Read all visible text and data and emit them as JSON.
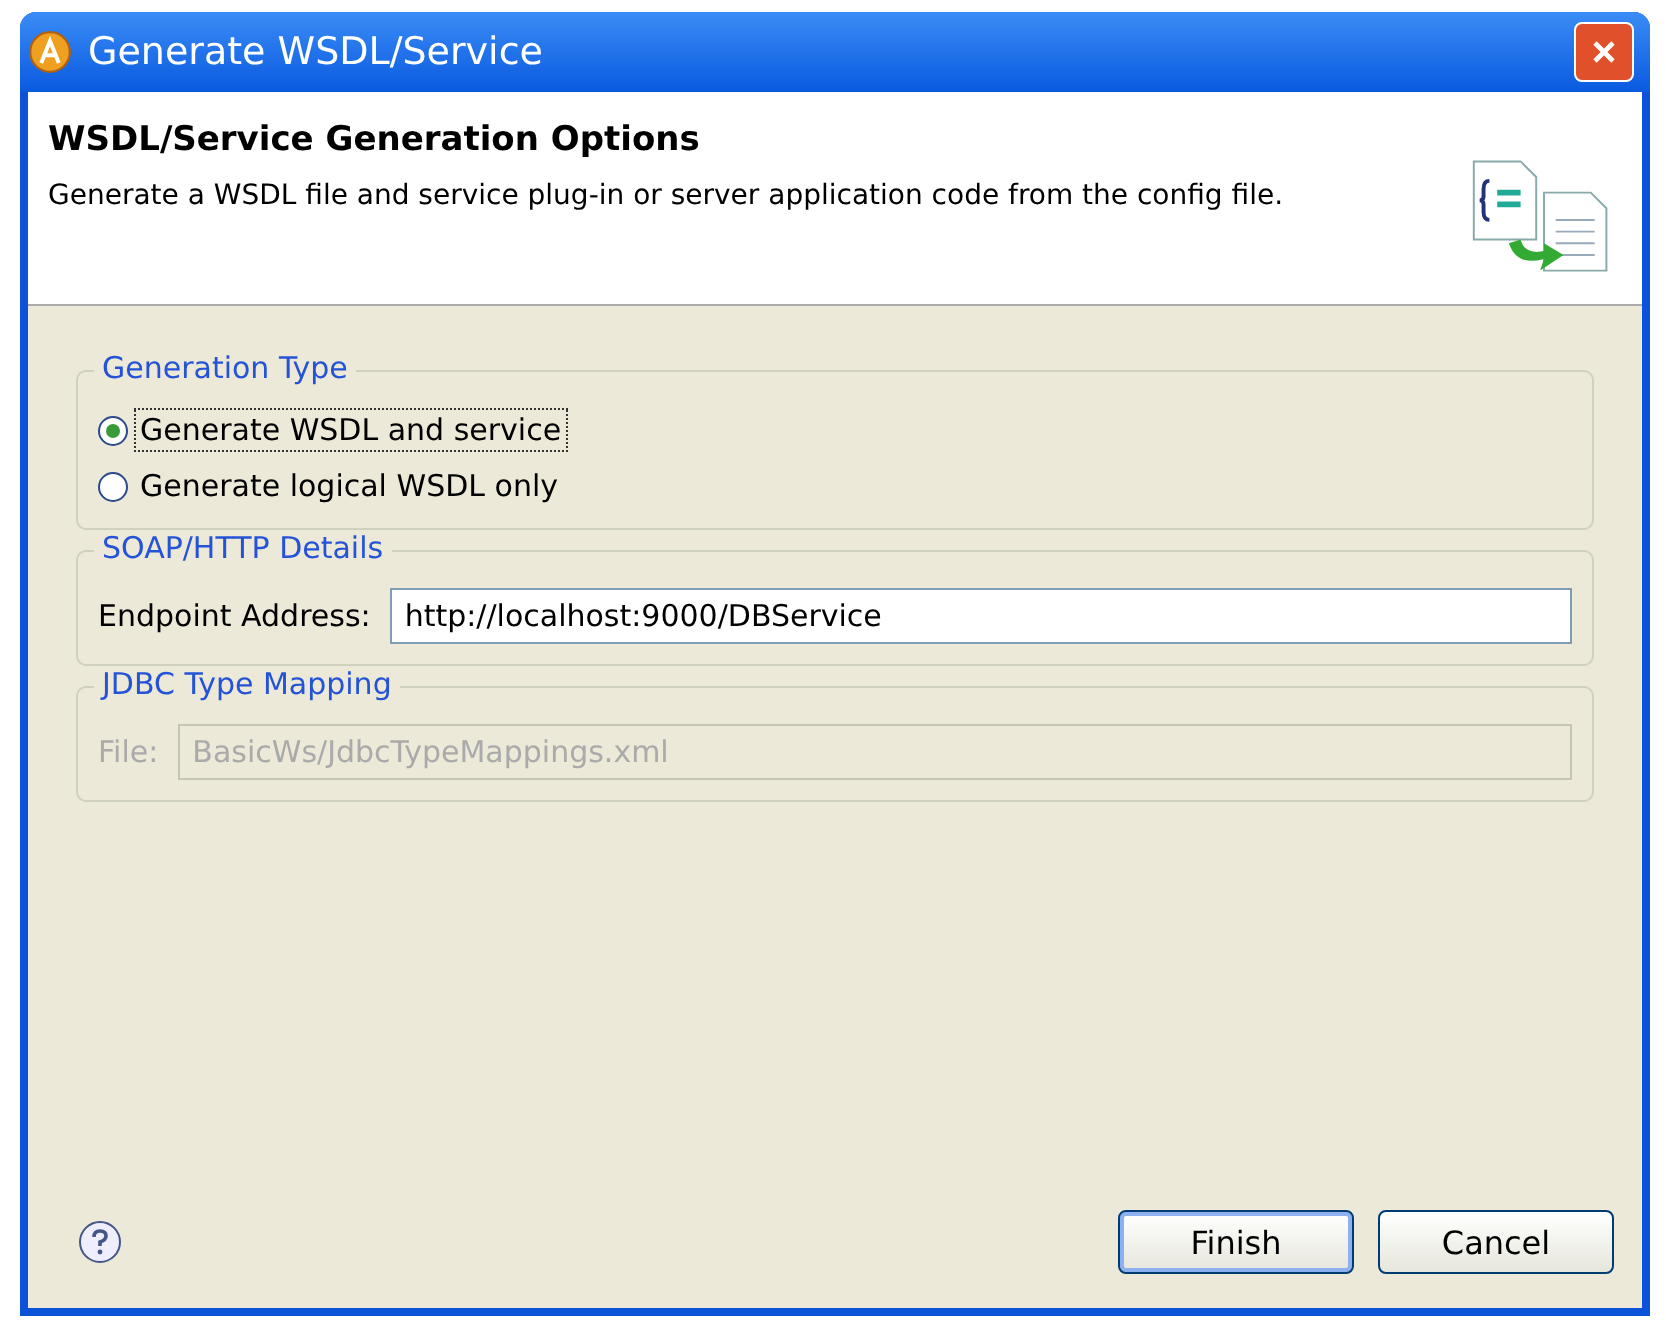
{
  "window": {
    "title": "Generate WSDL/Service"
  },
  "header": {
    "title": "WSDL/Service Generation Options",
    "description": "Generate a WSDL file and service plug-in or server application code from the config file."
  },
  "groups": [
    {
      "kind": "radios",
      "title": "Generation Type",
      "options": [
        {
          "label": "Generate WSDL and service",
          "selected": true
        },
        {
          "label": "Generate logical WSDL only",
          "selected": false
        }
      ]
    },
    {
      "kind": "field",
      "title": "SOAP/HTTP Details",
      "label": "Endpoint Address:",
      "value": "http://localhost:9000/DBService",
      "disabled": false
    },
    {
      "kind": "field",
      "title": "JDBC Type Mapping",
      "label": "File:",
      "value": "BasicWs/JdbcTypeMappings.xml",
      "disabled": true
    }
  ],
  "buttons": [
    {
      "label": "Finish",
      "default": true
    },
    {
      "label": "Cancel",
      "default": false
    }
  ]
}
